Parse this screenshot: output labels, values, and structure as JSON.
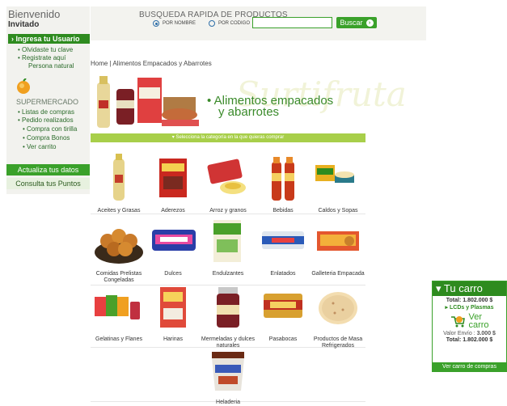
{
  "sidebar": {
    "welcome": "Bienvenido",
    "guest": "Invitado",
    "login_label": "Ingresa tu Usuario",
    "links_a": [
      "Olvidaste tu clave",
      "Registrate aquí",
      "Persona natural"
    ],
    "section_title": "SUPERMERCADO",
    "links_b": [
      "Listas de compras",
      "Pedido realizados",
      "Compra con tirilla",
      "Compra Bonos",
      "Ver carrito"
    ],
    "btn_update": "Actualiza tus datos",
    "btn_points": "Consulta tus Puntos"
  },
  "search": {
    "title": "BUSQUEDA RAPIDA DE PRODUCTOS",
    "opt_name": "POR NOMBRE",
    "opt_code": "POR CODIGO",
    "input_value": "",
    "button": "Buscar"
  },
  "breadcrumb": "Home | Alimentos Empacados y Abarrotes",
  "banner": {
    "bullet": "•",
    "title_line1": "Alimentos empacados",
    "title_line2": "y abarrotes",
    "watermark": "Surtifruta",
    "select_text": "Selecciona la categoría en la que quieras comprar"
  },
  "products": [
    {
      "label": "Aceites y Grasas",
      "icon": "oil-bottle"
    },
    {
      "label": "Aderezos",
      "icon": "dressing-bag"
    },
    {
      "label": "Arroz y granos",
      "icon": "rice-pack"
    },
    {
      "label": "Bebidas",
      "icon": "drink-bottles"
    },
    {
      "label": "Caldos y Sopas",
      "icon": "soup-box"
    },
    {
      "label": "Comidas Prelistas Congeladas",
      "icon": "frozen-food"
    },
    {
      "label": "Dulces",
      "icon": "candy-bag"
    },
    {
      "label": "Endulzantes",
      "icon": "sweetener-pack"
    },
    {
      "label": "Enlatados",
      "icon": "tin-can"
    },
    {
      "label": "Galleteria Empacada",
      "icon": "cookie-pack"
    },
    {
      "label": "Gelatinas y Flanes",
      "icon": "gelatin-boxes"
    },
    {
      "label": "Harinas",
      "icon": "flour-bag"
    },
    {
      "label": "Mermeladas y dulces naturales",
      "icon": "jam-jar"
    },
    {
      "label": "Pasabocas",
      "icon": "snack-can"
    },
    {
      "label": "Productos de Masa Refrigerados",
      "icon": "tortilla"
    },
    {
      "label": "Heladeria",
      "icon": "ice-cream-tub"
    }
  ],
  "cart": {
    "title": "Tu carro",
    "total_label": "Total:",
    "total_value": "1.802.000 $",
    "item": "LCDs y Plasmas",
    "ver_line1": "Ver",
    "ver_line2": "carro",
    "shipping_label": "Valor Envío :",
    "shipping_value": "3.000 $",
    "total2_label": "Total:",
    "total2_value": "1.802.000 $",
    "footer": "Ver carro de compras"
  },
  "colors": {
    "brand_green": "#2e8b1f",
    "accent_green": "#3aa12a",
    "category_bar": "#a8cf4a"
  }
}
